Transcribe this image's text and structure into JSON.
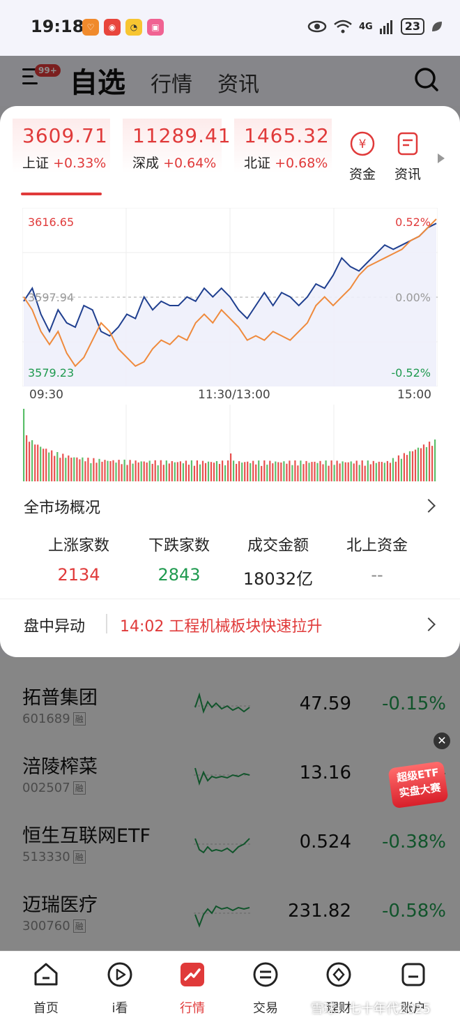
{
  "status": {
    "time": "19:18",
    "battery": "23",
    "network": "4G"
  },
  "header": {
    "badge": "99+",
    "tabs": [
      "自选",
      "行情",
      "资讯"
    ]
  },
  "indices": [
    {
      "value": "3609.71",
      "name": "上证",
      "change": "+0.33%"
    },
    {
      "value": "11289.41",
      "name": "深成",
      "change": "+0.64%"
    },
    {
      "value": "1465.32",
      "name": "北证",
      "change": "+0.68%"
    }
  ],
  "quick": [
    {
      "label": "资金",
      "icon": "yuan-circle-icon"
    },
    {
      "label": "资讯",
      "icon": "document-icon"
    }
  ],
  "chart": {
    "high_label": "3616.65",
    "mid_label": "3597.94",
    "low_label": "3579.23",
    "pct_high": "0.52%",
    "pct_mid": "0.00%",
    "pct_low": "-0.52%",
    "times": [
      "09:30",
      "11:30/13:00",
      "15:00"
    ]
  },
  "chart_data": {
    "type": "line",
    "x": [
      "09:30",
      "11:30/13:00",
      "15:00"
    ],
    "ylim": [
      3579.23,
      3616.65
    ],
    "series": [
      {
        "color": "#1f3f8f",
        "values": [
          3597,
          3600,
          3594,
          3590,
          3595,
          3592,
          3591,
          3596,
          3595,
          3590,
          3589,
          3591,
          3594,
          3593,
          3598,
          3595,
          3597,
          3596,
          3596,
          3598,
          3597,
          3600,
          3598,
          3600,
          3598,
          3595,
          3593,
          3596,
          3599,
          3596,
          3599,
          3598,
          3596,
          3598,
          3601,
          3600,
          3603,
          3607,
          3605,
          3604,
          3606,
          3608,
          3610,
          3609,
          3610,
          3611,
          3612,
          3614,
          3615
        ]
      },
      {
        "color": "#ef8a3c",
        "values": [
          3598,
          3595,
          3590,
          3587,
          3590,
          3585,
          3582,
          3584,
          3588,
          3592,
          3590,
          3586,
          3584,
          3582,
          3583,
          3586,
          3588,
          3587,
          3589,
          3588,
          3592,
          3594,
          3592,
          3595,
          3593,
          3591,
          3588,
          3589,
          3588,
          3590,
          3589,
          3588,
          3590,
          3592,
          3596,
          3598,
          3596,
          3598,
          3600,
          3603,
          3605,
          3606,
          3607,
          3608,
          3609,
          3611,
          3612,
          3614,
          3616
        ]
      }
    ]
  },
  "overview": {
    "title": "全市场概况",
    "stats": [
      {
        "label": "上涨家数",
        "value": "2134",
        "color": "#e03a3a"
      },
      {
        "label": "下跌家数",
        "value": "2843",
        "color": "#1f9a4f"
      },
      {
        "label": "成交金额",
        "value": "18032亿",
        "color": "#222222"
      },
      {
        "label": "北上资金",
        "value": "--",
        "color": "#888888"
      }
    ]
  },
  "alert": {
    "title": "盘中异动",
    "text": "14:02  工程机械板块快速拉升"
  },
  "watchlist": [
    {
      "name": "拓普集团",
      "code": "601689",
      "tag": "融",
      "price": "47.59",
      "change": "-0.15%"
    },
    {
      "name": "涪陵榨菜",
      "code": "002507",
      "tag": "融",
      "price": "13.16",
      "change": "-"
    },
    {
      "name": "恒生互联网ETF",
      "code": "513330",
      "tag": "融",
      "price": "0.524",
      "change": "-0.38%"
    },
    {
      "name": "迈瑞医疗",
      "code": "300760",
      "tag": "融",
      "price": "231.82",
      "change": "-0.58%"
    }
  ],
  "promo": {
    "line1": "超级ETF",
    "line2": "实盘大赛"
  },
  "tabbar": [
    {
      "label": "首页",
      "icon": "home-icon"
    },
    {
      "label": "i看",
      "icon": "play-icon"
    },
    {
      "label": "行情",
      "icon": "trend-icon"
    },
    {
      "label": "交易",
      "icon": "exchange-icon"
    },
    {
      "label": "理财",
      "icon": "diamond-icon"
    },
    {
      "label": "账户",
      "icon": "account-icon"
    }
  ],
  "watermark": "雪球：七十年代2025"
}
